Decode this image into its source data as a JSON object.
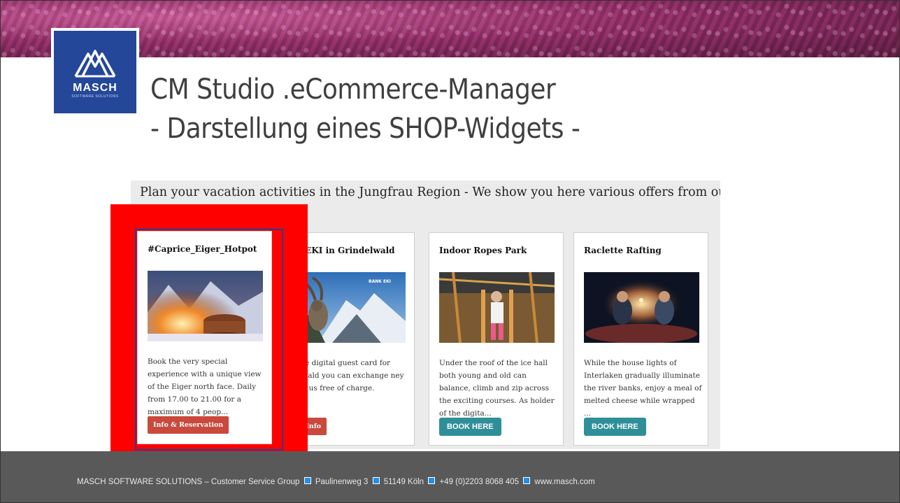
{
  "logo": {
    "word": "MASCH",
    "sub": "SOFTWARE SOLUTIONS"
  },
  "title": {
    "line1": "CM Studio .eCommerce-Manager",
    "line2": "- Darstellung eines SHOP-Widgets -"
  },
  "widget": {
    "intro": "Plan your vacation activities in the Jungfrau Region - We show you here various offers from our",
    "cards": [
      {
        "title": "#Caprice_Eiger_Hotpot",
        "image_icon": "hotpot-photo",
        "description": "Book the very special experience with a unique view of the Eiger north face. Daily from 17.00 to 21.00 for a maximum of 4 peop...",
        "button": "Info & Reservation"
      },
      {
        "title": "nk EKI in Grindelwald",
        "image_icon": "ibex-mountain-photo",
        "badge": "BANK EKI",
        "description": "n the digital guest card for delwald you can exchange ney with us free of charge.",
        "button": "re Info"
      },
      {
        "title": "Indoor Ropes Park",
        "image_icon": "ropes-park-photo",
        "description": "Under the roof of the ice hall both young and old can balance, climb and zip across the exciting courses. As holder of the digita...",
        "button": "BOOK HERE"
      },
      {
        "title": "Raclette Rafting",
        "image_icon": "raclette-rafting-photo",
        "description": "While the house lights of Interlaken gradually illuminate the river banks, enjoy a meal of melted cheese while wrapped ...",
        "button": "BOOK HERE"
      }
    ]
  },
  "footer": {
    "company": "MASCH SOFTWARE SOLUTIONS – Customer Service Group",
    "street": "Paulinenweg 3",
    "city": "51149 Köln",
    "phone": "+49 (0)2203 8068 405",
    "web": "www.masch.com"
  },
  "colors": {
    "highlight": "#ff0000",
    "logo_bg": "#24479a",
    "red_button": "#c9493d",
    "teal_button": "#2f8f98",
    "footer_bg": "#595959",
    "bullet": "#1f8fe8"
  }
}
